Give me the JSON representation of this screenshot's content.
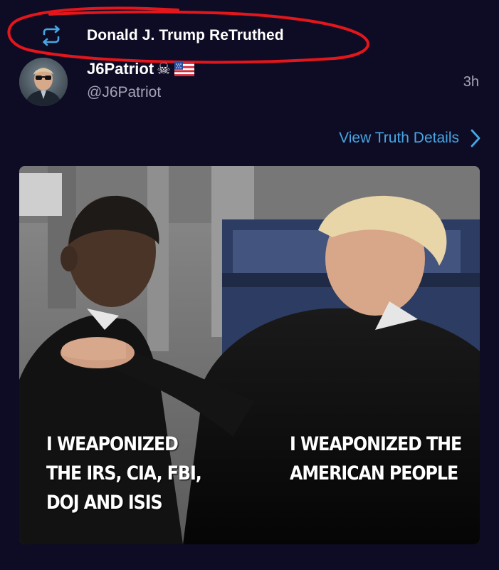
{
  "retruth": {
    "label": "Donald J. Trump ReTruthed",
    "icon": "retruth-icon",
    "annotation_color": "#e3161c"
  },
  "author": {
    "name": "J6Patriot",
    "handle": "@J6Patriot",
    "badges": [
      "skull-crossbones-icon",
      "us-flag-icon"
    ],
    "timestamp": "3h"
  },
  "view_details": {
    "label": "View Truth Details",
    "icon": "chevron-right-icon",
    "color": "#47a6e4"
  },
  "media": {
    "left_caption": [
      "I WEAPONIZED",
      "THE IRS, CIA, FBI,",
      "DOJ AND ISIS"
    ],
    "right_caption": [
      "I WEAPONIZED THE",
      "AMERICAN PEOPLE"
    ]
  },
  "colors": {
    "background": "#0e0c24",
    "text_secondary": "#a4a3b8",
    "accent": "#47a6e4"
  }
}
